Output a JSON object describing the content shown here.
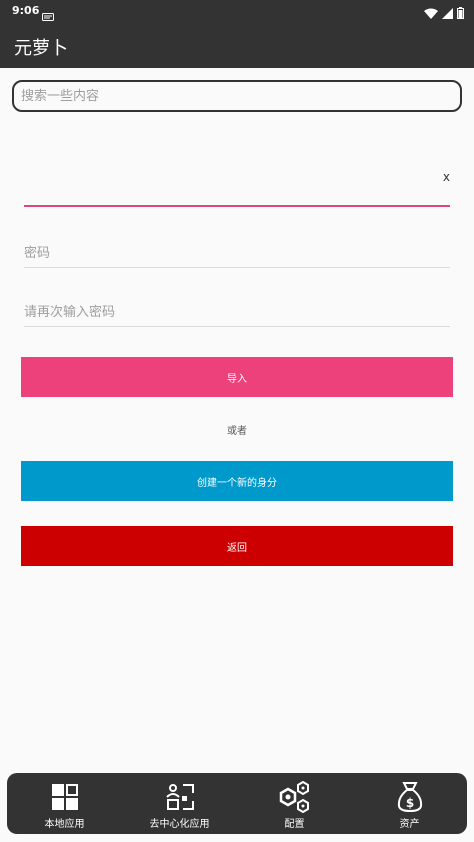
{
  "status_bar": {
    "time": "9:06"
  },
  "app_bar": {
    "title": "元萝卜"
  },
  "search": {
    "placeholder": "搜索一些内容"
  },
  "form": {
    "mnemonic_clear": "x",
    "password_placeholder": "密码",
    "confirm_password_placeholder": "请再次输入密码",
    "import_label": "导入",
    "or_text": "或者",
    "create_label": "创建一个新的身分",
    "back_label": "返回"
  },
  "bottom_nav": {
    "items": [
      {
        "label": "本地应用",
        "icon": "grid-apps-icon"
      },
      {
        "label": "去中心化应用",
        "icon": "people-network-icon"
      },
      {
        "label": "配置",
        "icon": "hexagon-settings-icon"
      },
      {
        "label": "资产",
        "icon": "money-bag-icon"
      }
    ]
  },
  "colors": {
    "bar": "#333333",
    "accent_pink": "#ec417a",
    "accent_blue": "#0099cc",
    "accent_red": "#cc0000",
    "background": "#fafafa"
  }
}
